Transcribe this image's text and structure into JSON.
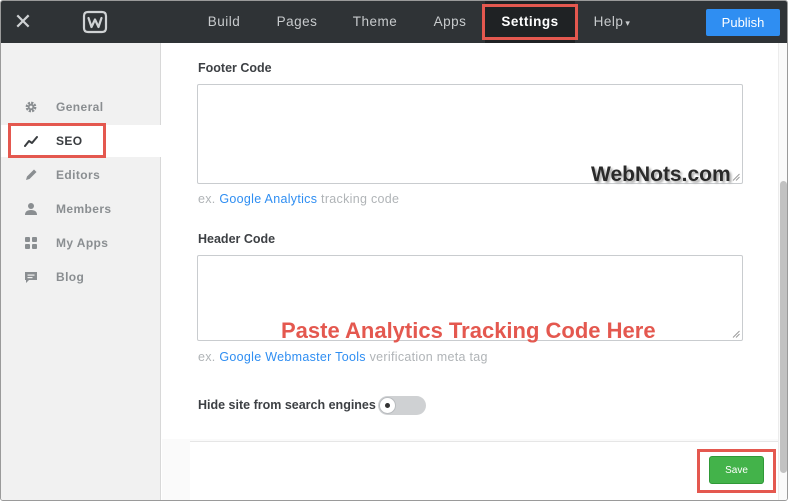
{
  "topbar": {
    "close_icon": "close-icon",
    "logo_icon": "weebly-logo-icon",
    "nav": [
      {
        "label": "Build"
      },
      {
        "label": "Pages"
      },
      {
        "label": "Theme"
      },
      {
        "label": "Apps"
      },
      {
        "label": "Settings",
        "active": true
      },
      {
        "label": "Help"
      }
    ],
    "publish_label": "Publish"
  },
  "sidebar": {
    "items": [
      {
        "label": "General",
        "icon": "gear-icon"
      },
      {
        "label": "SEO",
        "icon": "trend-line-icon",
        "active": true
      },
      {
        "label": "Editors",
        "icon": "pencil-icon"
      },
      {
        "label": "Members",
        "icon": "person-icon"
      },
      {
        "label": "My Apps",
        "icon": "grid-icon"
      },
      {
        "label": "Blog",
        "icon": "comment-icon"
      }
    ]
  },
  "main": {
    "footer_code": {
      "label": "Footer Code",
      "value": "",
      "hint_prefix": "ex. ",
      "hint_link": "Google Analytics",
      "hint_suffix": " tracking code"
    },
    "header_code": {
      "label": "Header Code",
      "value": "",
      "hint_prefix": "ex. ",
      "hint_link": "Google Webmaster Tools",
      "hint_suffix": " verification meta tag"
    },
    "watermark": "WebNots.com",
    "annotation": "Paste Analytics Tracking Code Here",
    "hide_site_label": "Hide site from search engines",
    "hide_site_enabled": false,
    "save_label": "Save"
  },
  "colors": {
    "topbar": "#2f3336",
    "publish": "#2f8ef2",
    "save": "#43b34a",
    "highlight": "#e4584f",
    "link": "#2f8ef2"
  }
}
